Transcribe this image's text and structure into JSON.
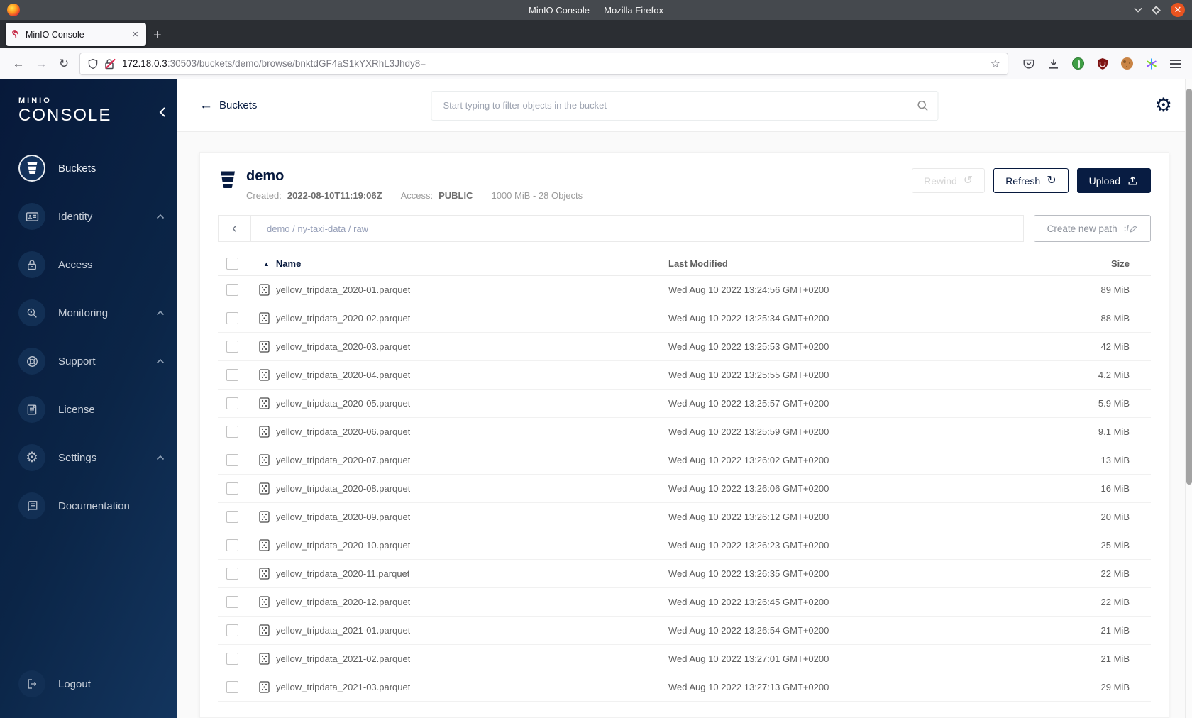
{
  "browser": {
    "window_title": "MinIO Console — Mozilla Firefox",
    "tab_title": "MinIO Console",
    "tab_close_label": "×",
    "new_tab_label": "+",
    "url_host": "172.18.0.3",
    "url_rest": ":30503/buckets/demo/browse/bnktdGF4aS1kYXRhL3Jhdy8="
  },
  "sidebar": {
    "logo_top": "MINIO",
    "logo_bottom": "CONSOLE",
    "items": [
      {
        "label": "Buckets",
        "icon": "buckets-icon",
        "active": true,
        "expandable": false
      },
      {
        "label": "Identity",
        "icon": "identity-icon",
        "active": false,
        "expandable": true
      },
      {
        "label": "Access",
        "icon": "access-icon",
        "active": false,
        "expandable": false
      },
      {
        "label": "Monitoring",
        "icon": "monitoring-icon",
        "active": false,
        "expandable": true
      },
      {
        "label": "Support",
        "icon": "support-icon",
        "active": false,
        "expandable": true
      },
      {
        "label": "License",
        "icon": "license-icon",
        "active": false,
        "expandable": false
      },
      {
        "label": "Settings",
        "icon": "settings-icon",
        "active": false,
        "expandable": true
      },
      {
        "label": "Documentation",
        "icon": "documentation-icon",
        "active": false,
        "expandable": false
      }
    ],
    "logout_label": "Logout"
  },
  "header": {
    "back_label": "Buckets",
    "search_placeholder": "Start typing to filter objects in the bucket"
  },
  "bucket": {
    "name": "demo",
    "created_label": "Created:",
    "created_value": "2022-08-10T11:19:06Z",
    "access_label": "Access:",
    "access_value": "PUBLIC",
    "summary": "1000 MiB - 28 Objects",
    "rewind_label": "Rewind",
    "refresh_label": "Refresh",
    "upload_label": "Upload"
  },
  "browse": {
    "breadcrumb": [
      "demo",
      "ny-taxi-data",
      "raw"
    ],
    "create_path_label": "Create new path"
  },
  "table": {
    "columns": [
      "Name",
      "Last Modified",
      "Size"
    ],
    "rows": [
      {
        "name": "yellow_tripdata_2020-01.parquet",
        "modified": "Wed Aug 10 2022 13:24:56 GMT+0200",
        "size": "89 MiB"
      },
      {
        "name": "yellow_tripdata_2020-02.parquet",
        "modified": "Wed Aug 10 2022 13:25:34 GMT+0200",
        "size": "88 MiB"
      },
      {
        "name": "yellow_tripdata_2020-03.parquet",
        "modified": "Wed Aug 10 2022 13:25:53 GMT+0200",
        "size": "42 MiB"
      },
      {
        "name": "yellow_tripdata_2020-04.parquet",
        "modified": "Wed Aug 10 2022 13:25:55 GMT+0200",
        "size": "4.2 MiB"
      },
      {
        "name": "yellow_tripdata_2020-05.parquet",
        "modified": "Wed Aug 10 2022 13:25:57 GMT+0200",
        "size": "5.9 MiB"
      },
      {
        "name": "yellow_tripdata_2020-06.parquet",
        "modified": "Wed Aug 10 2022 13:25:59 GMT+0200",
        "size": "9.1 MiB"
      },
      {
        "name": "yellow_tripdata_2020-07.parquet",
        "modified": "Wed Aug 10 2022 13:26:02 GMT+0200",
        "size": "13 MiB"
      },
      {
        "name": "yellow_tripdata_2020-08.parquet",
        "modified": "Wed Aug 10 2022 13:26:06 GMT+0200",
        "size": "16 MiB"
      },
      {
        "name": "yellow_tripdata_2020-09.parquet",
        "modified": "Wed Aug 10 2022 13:26:12 GMT+0200",
        "size": "20 MiB"
      },
      {
        "name": "yellow_tripdata_2020-10.parquet",
        "modified": "Wed Aug 10 2022 13:26:23 GMT+0200",
        "size": "25 MiB"
      },
      {
        "name": "yellow_tripdata_2020-11.parquet",
        "modified": "Wed Aug 10 2022 13:26:35 GMT+0200",
        "size": "22 MiB"
      },
      {
        "name": "yellow_tripdata_2020-12.parquet",
        "modified": "Wed Aug 10 2022 13:26:45 GMT+0200",
        "size": "22 MiB"
      },
      {
        "name": "yellow_tripdata_2021-01.parquet",
        "modified": "Wed Aug 10 2022 13:26:54 GMT+0200",
        "size": "21 MiB"
      },
      {
        "name": "yellow_tripdata_2021-02.parquet",
        "modified": "Wed Aug 10 2022 13:27:01 GMT+0200",
        "size": "21 MiB"
      },
      {
        "name": "yellow_tripdata_2021-03.parquet",
        "modified": "Wed Aug 10 2022 13:27:13 GMT+0200",
        "size": "29 MiB"
      }
    ]
  },
  "colors": {
    "brand_navy": "#081c42",
    "sidebar_gradient_start": "#07193a",
    "sidebar_gradient_end": "#13355e",
    "titlebar": "#45494e",
    "close_button": "#e95420",
    "muted_text": "#9b9b9b",
    "row_text": "#5e5e5e"
  }
}
